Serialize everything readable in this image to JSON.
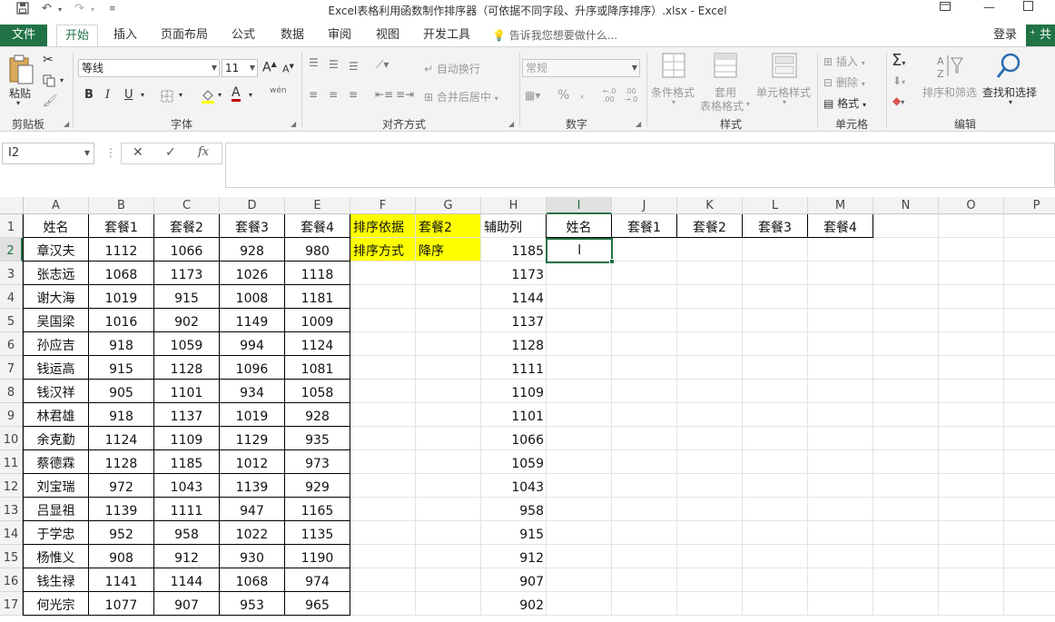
{
  "title_bar": {
    "title": "Excel表格利用函数制作排序器（可依据不同字段、升序或降序排序）.xlsx - Excel",
    "save_icon": "save-icon",
    "undo_icon": "undo-icon",
    "redo_icon": "redo-icon"
  },
  "tabs": {
    "file": "文件",
    "items": [
      "开始",
      "插入",
      "页面布局",
      "公式",
      "数据",
      "审阅",
      "视图",
      "开发工具"
    ],
    "active": "开始",
    "tell_me": "告诉我您想要做什么...",
    "login": "登录",
    "share": "共"
  },
  "ribbon": {
    "clipboard": {
      "label": "剪贴板",
      "paste": "粘贴"
    },
    "font": {
      "label": "字体",
      "font_name": "等线",
      "font_size": "11",
      "bold": "B",
      "italic": "I",
      "underline": "U",
      "grow": "A",
      "shrink": "A",
      "font_color_letter": "A",
      "wen": "wén"
    },
    "alignment": {
      "label": "对齐方式",
      "wrap_text": "自动换行",
      "merge_center": "合并后居中"
    },
    "number": {
      "label": "数字",
      "format": "常规",
      "percent": "%",
      "comma": ",",
      "inc_dec": "←.0 .00",
      "dec_dec": ".00 →.0"
    },
    "styles": {
      "label": "样式",
      "conditional": "条件格式",
      "table_line1": "套用",
      "table_line2": "表格格式",
      "cell_styles": "单元格样式"
    },
    "cells": {
      "label": "单元格",
      "insert": "插入",
      "delete": "删除",
      "format": "格式"
    },
    "editing": {
      "label": "编辑",
      "sort_filter": "排序和筛选",
      "find_select": "查找和选择"
    }
  },
  "formula_bar": {
    "name_box": "I2",
    "formula": "",
    "cancel": "✕",
    "enter": "✓",
    "fx": "fx"
  },
  "sheet": {
    "columns": [
      "A",
      "B",
      "C",
      "D",
      "E",
      "F",
      "G",
      "H",
      "I",
      "J",
      "K",
      "L",
      "M",
      "N",
      "O",
      "P"
    ],
    "selected_column": "I",
    "selected_row": 2,
    "active_cell": "I2",
    "row_numbers": [
      "1",
      "2",
      "3",
      "4",
      "5",
      "6",
      "7",
      "8",
      "9",
      "10",
      "11",
      "12",
      "13",
      "14",
      "15",
      "16",
      "17"
    ],
    "headers": [
      "姓名",
      "套餐1",
      "套餐2",
      "套餐3",
      "套餐4"
    ],
    "data": [
      [
        "章汉夫",
        "1112",
        "1066",
        "928",
        "980"
      ],
      [
        "张志远",
        "1068",
        "1173",
        "1026",
        "1118"
      ],
      [
        "谢大海",
        "1019",
        "915",
        "1008",
        "1181"
      ],
      [
        "吴国梁",
        "1016",
        "902",
        "1149",
        "1009"
      ],
      [
        "孙应吉",
        "918",
        "1059",
        "994",
        "1124"
      ],
      [
        "钱运高",
        "915",
        "1128",
        "1096",
        "1081"
      ],
      [
        "钱汉祥",
        "905",
        "1101",
        "934",
        "1058"
      ],
      [
        "林君雄",
        "918",
        "1137",
        "1019",
        "928"
      ],
      [
        "余克勤",
        "1124",
        "1109",
        "1129",
        "935"
      ],
      [
        "蔡德霖",
        "1128",
        "1185",
        "1012",
        "973"
      ],
      [
        "刘宝瑞",
        "972",
        "1043",
        "1139",
        "929"
      ],
      [
        "吕显祖",
        "1139",
        "1111",
        "947",
        "1165"
      ],
      [
        "于学忠",
        "952",
        "958",
        "1022",
        "1135"
      ],
      [
        "杨惟义",
        "908",
        "912",
        "930",
        "1190"
      ],
      [
        "钱生禄",
        "1141",
        "1144",
        "1068",
        "974"
      ],
      [
        "何光宗",
        "1077",
        "907",
        "953",
        "965"
      ]
    ],
    "sort_by_label": "排序依据",
    "sort_by_value": "套餐2",
    "sort_order_label": "排序方式",
    "sort_order_value": "降序",
    "helper_header": "辅助列",
    "helper_values": [
      "1185",
      "1173",
      "1144",
      "1137",
      "1128",
      "1111",
      "1109",
      "1101",
      "1066",
      "1059",
      "1043",
      "958",
      "915",
      "912",
      "907",
      "902"
    ],
    "result_headers": [
      "姓名",
      "套餐1",
      "套餐2",
      "套餐3",
      "套餐4"
    ],
    "highlight_color": "#ffff00",
    "accent_color": "#217346"
  }
}
